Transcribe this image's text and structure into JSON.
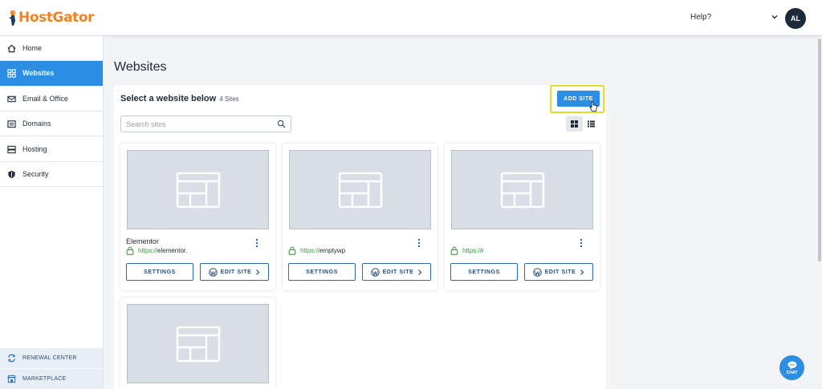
{
  "brand": {
    "name": "HostGator",
    "color": "#f4821f"
  },
  "header": {
    "help": "Help?",
    "avatar_initials": "AL"
  },
  "sidebar": {
    "items": [
      {
        "label": "Home",
        "icon": "home-icon"
      },
      {
        "label": "Websites",
        "icon": "websites-grid-icon",
        "active": true
      },
      {
        "label": "Email & Office",
        "icon": "mail-icon"
      },
      {
        "label": "Domains",
        "icon": "domains-icon"
      },
      {
        "label": "Hosting",
        "icon": "server-icon"
      },
      {
        "label": "Security",
        "icon": "shield-icon"
      }
    ],
    "bottom": [
      {
        "label": "RENEWAL CENTER",
        "icon": "renew-icon"
      },
      {
        "label": "MARKETPLACE",
        "icon": "store-icon"
      }
    ]
  },
  "main": {
    "title": "Websites",
    "select_title": "Select a website below",
    "site_count": "4 Sites",
    "add_site": "ADD SITE",
    "search_placeholder": "Search sites",
    "sites": [
      {
        "name": "Elementor",
        "proto": "https://",
        "url": "elementor.",
        "settings": "SETTINGS",
        "edit": "EDIT SITE"
      },
      {
        "name": "",
        "proto": "https://",
        "url": "emptywp",
        "settings": "SETTINGS",
        "edit": "EDIT SITE"
      },
      {
        "name": "",
        "proto": "https://",
        "url": "r",
        "settings": "SETTINGS",
        "edit": "EDIT SITE"
      },
      {
        "name": "",
        "proto": "",
        "url": "",
        "settings": "",
        "edit": ""
      }
    ]
  },
  "chat": {
    "label": "CHAT"
  },
  "colors": {
    "accent": "#2b8ee3",
    "highlight": "#e2dc2a",
    "secure": "#3b9b3f"
  }
}
